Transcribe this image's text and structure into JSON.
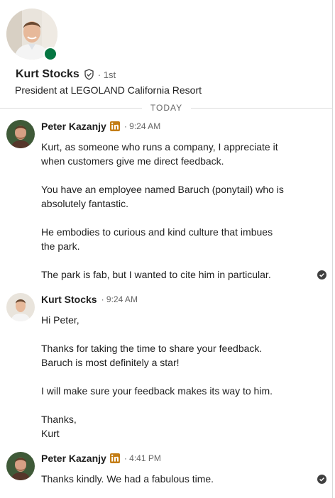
{
  "profile": {
    "name": "Kurt Stocks",
    "degree": "· 1st",
    "headline": "President at LEGOLAND California Resort"
  },
  "divider": {
    "label": "TODAY"
  },
  "messages": [
    {
      "sender": "Peter Kazanjy",
      "time": "· 9:24 AM",
      "lines": [
        "Kurt, as someone who runs a company, I appreciate it",
        "when customers give me direct feedback.",
        "You have an employee named Baruch (ponytail) who is",
        "absolutely fantastic.",
        "He embodies to curious and kind culture that imbues",
        "the park.",
        "The park is fab, but I wanted to cite him in particular."
      ]
    },
    {
      "sender": "Kurt Stocks",
      "time": "· 9:24 AM",
      "lines": [
        "Hi Peter,",
        "Thanks for taking the time to share your feedback.",
        "Baruch is most definitely a star!",
        "I will make sure your feedback makes its way to him.",
        "Thanks,",
        "Kurt"
      ]
    },
    {
      "sender": "Peter Kazanjy",
      "time": "· 4:41 PM",
      "lines": [
        "Thanks kindly. We had a fabulous time."
      ]
    }
  ]
}
